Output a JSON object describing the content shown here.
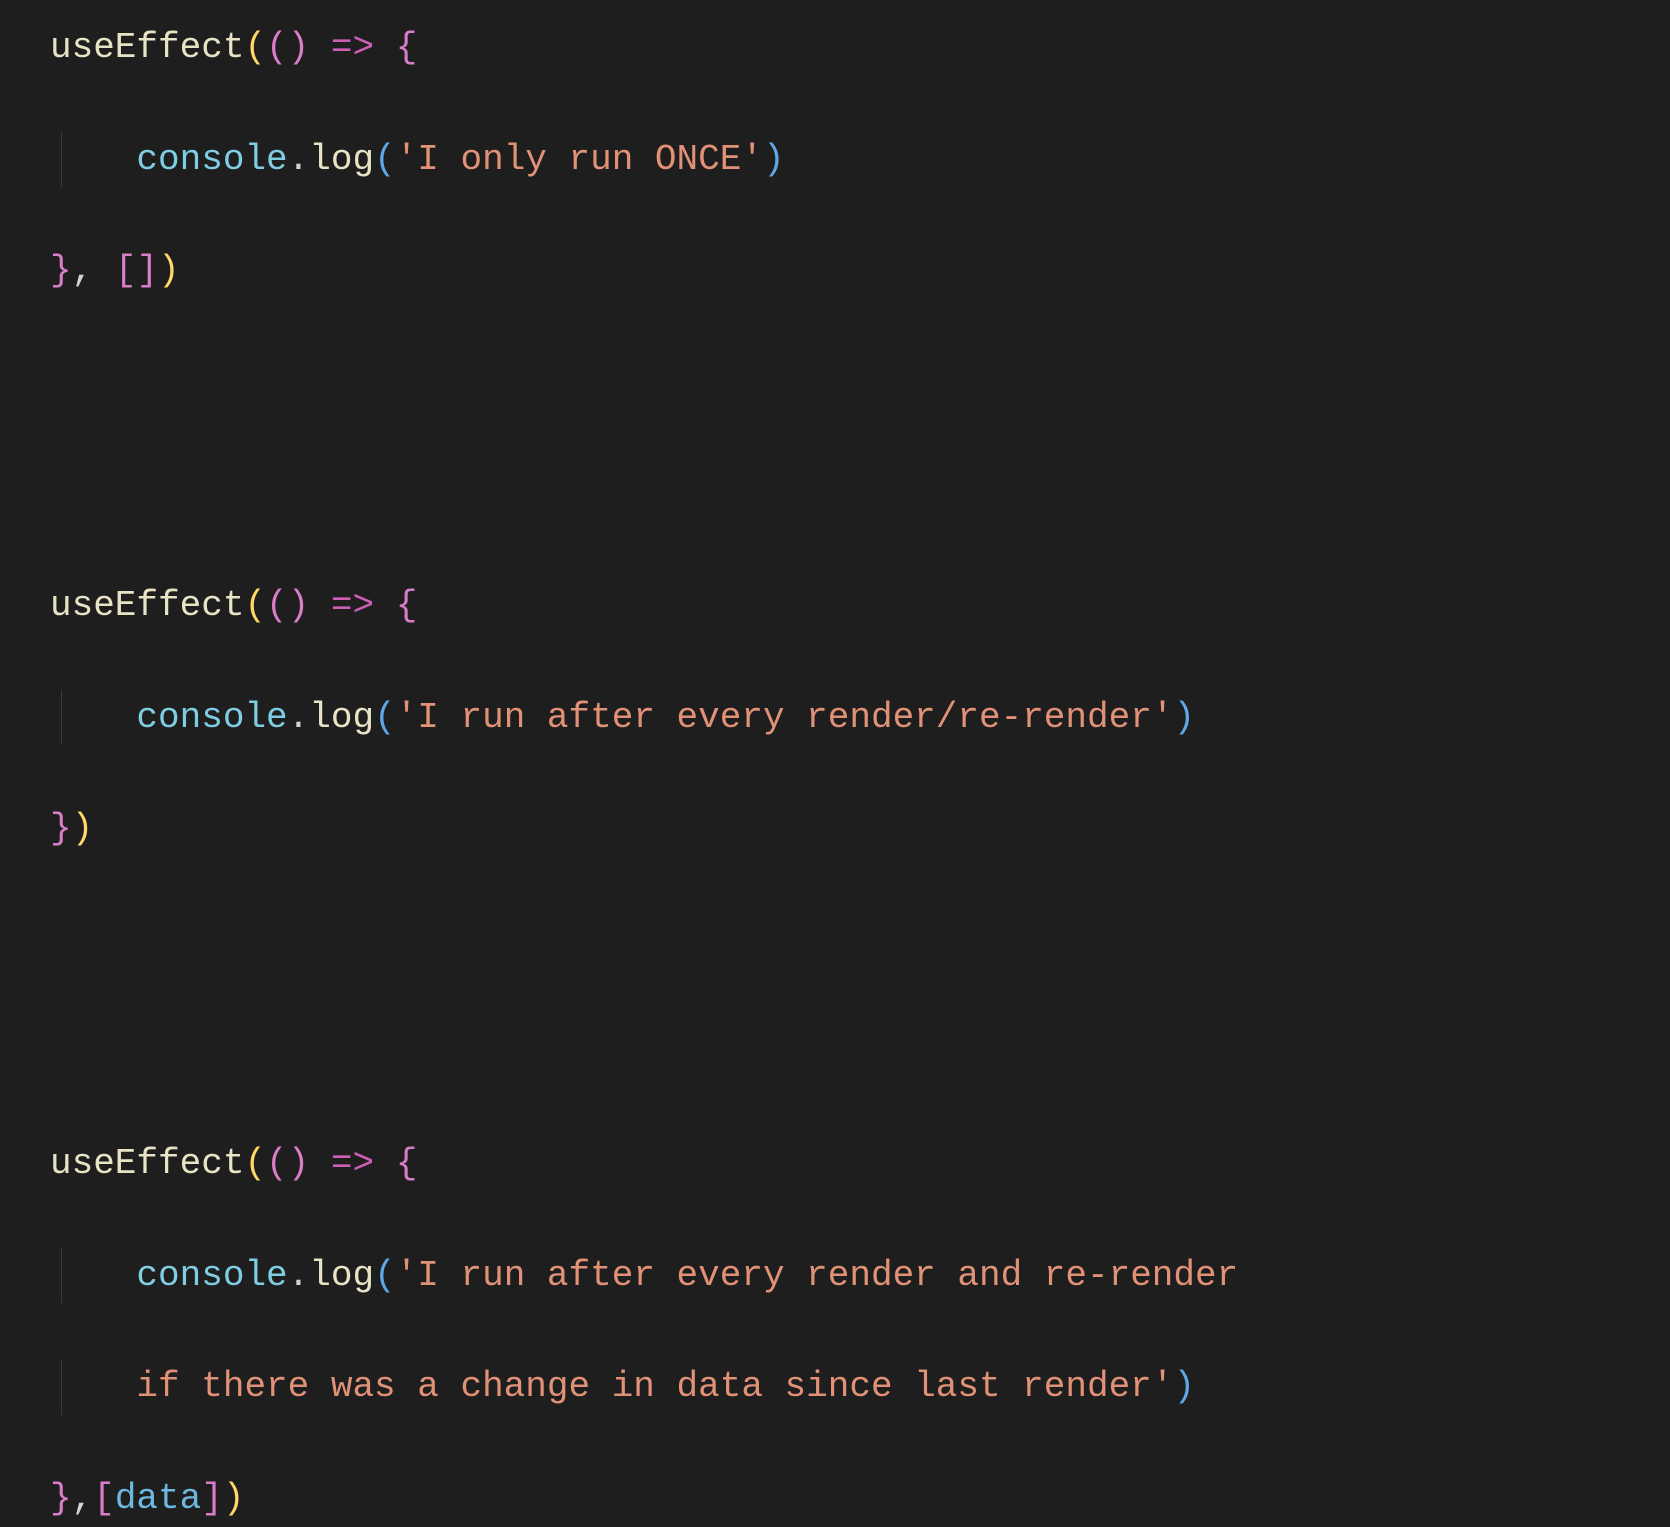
{
  "tokens": {
    "useEffect": "useEffect",
    "console": "console",
    "log": "log",
    "dot": ".",
    "arrow": "=>",
    "comma": ",",
    "openParen": "(",
    "closeParen": ")",
    "openBrace": "{",
    "closeBrace": "}",
    "openBracket": "[",
    "closeBracket": "]",
    "data": "data",
    "indent": "    "
  },
  "strings": {
    "s1": "'I only run ONCE'",
    "s2": "'I run after every render/re-render'",
    "s3a": "'I run after every render and re-render ",
    "s3b": "if there was a change in data since last render'"
  },
  "blank": " "
}
